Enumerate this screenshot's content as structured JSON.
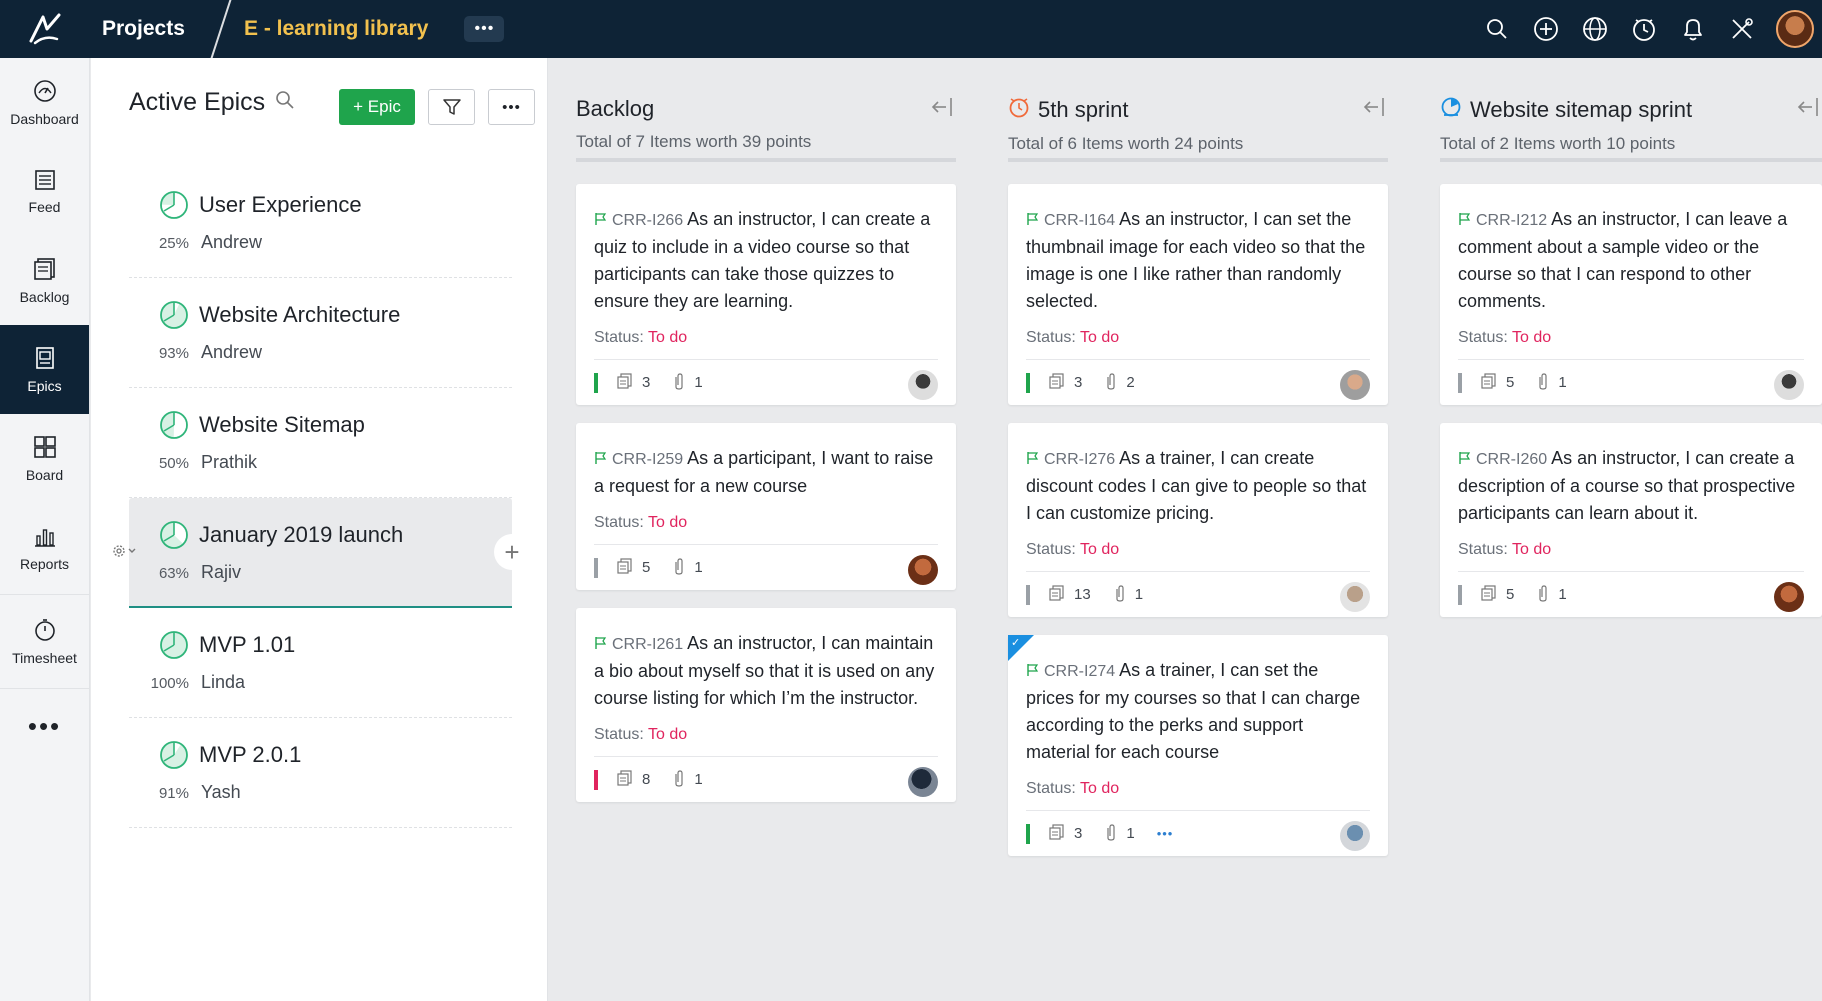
{
  "topbar": {
    "projects_label": "Projects",
    "project_name": "E - learning library",
    "more_label": "•••",
    "icons": [
      "search-icon",
      "add-icon",
      "globe-icon",
      "timer-icon",
      "bell-icon",
      "tools-icon"
    ]
  },
  "nav": {
    "items": [
      {
        "label": "Dashboard",
        "icon": "dashboard-icon"
      },
      {
        "label": "Feed",
        "icon": "feed-icon"
      },
      {
        "label": "Backlog",
        "icon": "backlog-icon"
      },
      {
        "label": "Epics",
        "icon": "epics-icon",
        "active": true
      },
      {
        "label": "Board",
        "icon": "board-icon"
      },
      {
        "label": "Reports",
        "icon": "reports-icon"
      },
      {
        "label": "Timesheet",
        "icon": "timesheet-icon"
      }
    ],
    "more_label": "•••"
  },
  "epics": {
    "title": "Active Epics",
    "add_label": "+ Epic",
    "more_label": "•••",
    "items": [
      {
        "name": "User Experience",
        "percent": "25%",
        "progress": 0.25,
        "owner": "Andrew"
      },
      {
        "name": "Website Architecture",
        "percent": "93%",
        "progress": 0.93,
        "owner": "Andrew"
      },
      {
        "name": "Website Sitemap",
        "percent": "50%",
        "progress": 0.5,
        "owner": "Prathik"
      },
      {
        "name": "January 2019 launch",
        "percent": "63%",
        "progress": 0.63,
        "owner": "Rajiv",
        "selected": true
      },
      {
        "name": "MVP 1.01",
        "percent": "100%",
        "progress": 1.0,
        "owner": "Linda"
      },
      {
        "name": "MVP 2.0.1",
        "percent": "91%",
        "progress": 0.91,
        "owner": "Yash"
      }
    ]
  },
  "status_label": "Status:",
  "columns": [
    {
      "title": "Backlog",
      "subtitle": "Total of 7 Items worth 39 points",
      "title_icon": "",
      "cards": [
        {
          "id": "CRR-I266",
          "text": "As an instructor, I can create a quiz to include in a video course so that participants can take those quizzes to ensure they are learning.",
          "status": "To do",
          "points": "3",
          "attachments": "1",
          "priority_color": "#1fa44c"
        },
        {
          "id": "CRR-I259",
          "text": "As a participant, I want to raise a request for a new course",
          "status": "To do",
          "points": "5",
          "attachments": "1",
          "priority_color": "#9aa0a6"
        },
        {
          "id": "CRR-I261",
          "text": "As an instructor, I can maintain a bio about myself so that it is used on any course listing for which I’m the instructor.",
          "status": "To do",
          "points": "8",
          "attachments": "1",
          "priority_color": "#e0245e"
        }
      ]
    },
    {
      "title": "5th sprint",
      "subtitle": "Total of 6 Items worth 24 points",
      "title_icon": "sprint-clock-icon",
      "cards": [
        {
          "id": "CRR-I164",
          "text": "As an instructor, I can set the thumbnail image for each video so that the image is one I like rather than randomly selected.",
          "status": "To do",
          "points": "3",
          "attachments": "2",
          "priority_color": "#1fa44c"
        },
        {
          "id": "CRR-I276",
          "text": "As a trainer, I can create discount codes I can give to people so that I can customize pricing.",
          "status": "To do",
          "points": "13",
          "attachments": "1",
          "priority_color": "#9aa0a6"
        },
        {
          "id": "CRR-I274",
          "text": "As a trainer, I can set the prices for my courses so that I can charge according to the perks and support material for each course",
          "status": "To do",
          "points": "3",
          "attachments": "1",
          "priority_color": "#1fa44c",
          "more": "•••",
          "checked": true
        }
      ]
    },
    {
      "title": "Website sitemap sprint",
      "subtitle": "Total of 2 Items worth 10 points",
      "title_icon": "sprint-target-icon",
      "cards": [
        {
          "id": "CRR-I212",
          "text": "As an instructor, I can leave a comment about a sample video or the course so that I can respond to other comments.",
          "status": "To do",
          "points": "5",
          "attachments": "1",
          "priority_color": "#9aa0a6"
        },
        {
          "id": "CRR-I260",
          "text": "As an instructor, I can create a description of a course so that prospective participants can learn about it.",
          "status": "To do",
          "points": "5",
          "attachments": "1",
          "priority_color": "#9aa0a6"
        }
      ]
    }
  ],
  "colors": {
    "topbar": "#0e2336",
    "project_name": "#f2c14e",
    "accent_green": "#1fa44c",
    "status_todo": "#e0245e",
    "epic_ring": "#2fb57a"
  }
}
